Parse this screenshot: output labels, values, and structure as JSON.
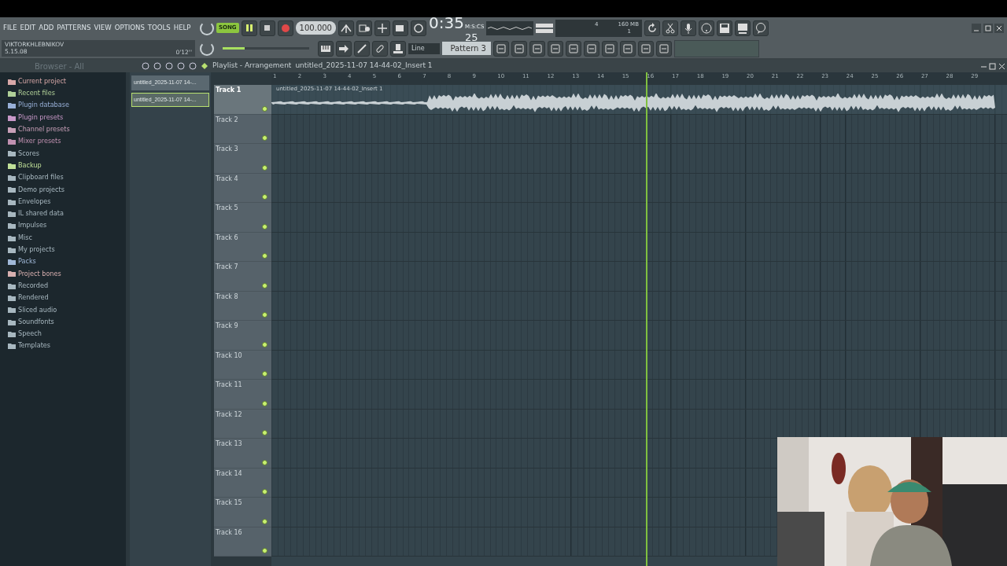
{
  "menu": [
    "FILE",
    "EDIT",
    "ADD",
    "PATTERNS",
    "VIEW",
    "OPTIONS",
    "TOOLS",
    "HELP"
  ],
  "hint_panel": {
    "user": "VIKTORKHLEBNIKOV",
    "version": "5.15.08",
    "time": "0'12''"
  },
  "transport": {
    "mode": "SONG",
    "song_mode": true,
    "playing": true,
    "tempo": "100.000",
    "master_volume": {
      "level": 0.25
    }
  },
  "clock": {
    "time": "0:35",
    "fraction": "25",
    "unit": "M:S:CS"
  },
  "monitor": {
    "voices": "4",
    "memory": "160 MB",
    "polyphony": "1"
  },
  "snap": "Line",
  "pattern": "Pattern 3",
  "browser": {
    "title": "Browser - All",
    "items": [
      {
        "label": "Current project",
        "color": "#d8a8a8"
      },
      {
        "label": "Recent files",
        "color": "#b0d098"
      },
      {
        "label": "Plugin database",
        "color": "#98b0d8"
      },
      {
        "label": "Plugin presets",
        "color": "#c898c8"
      },
      {
        "label": "Channel presets",
        "color": "#c8a0b8"
      },
      {
        "label": "Mixer presets",
        "color": "#c090b0"
      },
      {
        "label": "Scores",
        "color": "#a8b8c0"
      },
      {
        "label": "Backup",
        "color": "#c0e098"
      },
      {
        "label": "Clipboard files",
        "color": "#a8b8c0"
      },
      {
        "label": "Demo projects",
        "color": "#a8b8c0"
      },
      {
        "label": "Envelopes",
        "color": "#a8b8c0"
      },
      {
        "label": "IL shared data",
        "color": "#a8b8c0"
      },
      {
        "label": "Impulses",
        "color": "#a8b8c0"
      },
      {
        "label": "Misc",
        "color": "#a8b8c0"
      },
      {
        "label": "My projects",
        "color": "#a8b8c0"
      },
      {
        "label": "Packs",
        "color": "#a0b8d8"
      },
      {
        "label": "Project bones",
        "color": "#d8b0b0"
      },
      {
        "label": "Recorded",
        "color": "#a8b8c0"
      },
      {
        "label": "Rendered",
        "color": "#a8b8c0"
      },
      {
        "label": "Sliced audio",
        "color": "#a8b8c0"
      },
      {
        "label": "Soundfonts",
        "color": "#a8b8c0"
      },
      {
        "label": "Speech",
        "color": "#a8b8c0"
      },
      {
        "label": "Templates",
        "color": "#a8b8c0"
      }
    ]
  },
  "playlist": {
    "title": "Playlist - Arrangement",
    "clip_name": "untitled_2025-11-07 14-44-02_Insert 1",
    "clips": [
      {
        "label": "untitled_2025-11-07 14-...",
        "selected": false
      },
      {
        "label": "untitled_2025-11-07 14-...",
        "selected": true
      }
    ],
    "bars": [
      "1",
      "2",
      "3",
      "4",
      "5",
      "6",
      "7",
      "8",
      "9",
      "10",
      "11",
      "12",
      "13",
      "14",
      "15",
      "16",
      "17",
      "18",
      "19",
      "20",
      "21",
      "22",
      "23",
      "24",
      "25",
      "26",
      "27",
      "28",
      "29"
    ],
    "playhead": {
      "level": 0.509
    },
    "tracks": [
      {
        "name": "Track 1",
        "selected": true,
        "clip": "untitled_2025-11-07 14-44-02_Insert 1"
      },
      {
        "name": "Track 2",
        "selected": false
      },
      {
        "name": "Track 3",
        "selected": false
      },
      {
        "name": "Track 4",
        "selected": false
      },
      {
        "name": "Track 5",
        "selected": false
      },
      {
        "name": "Track 6",
        "selected": false
      },
      {
        "name": "Track 7",
        "selected": false
      },
      {
        "name": "Track 8",
        "selected": false
      },
      {
        "name": "Track 9",
        "selected": false
      },
      {
        "name": "Track 10",
        "selected": false
      },
      {
        "name": "Track 11",
        "selected": false
      },
      {
        "name": "Track 12",
        "selected": false
      },
      {
        "name": "Track 13",
        "selected": false
      },
      {
        "name": "Track 14",
        "selected": false
      },
      {
        "name": "Track 15",
        "selected": false
      },
      {
        "name": "Track 16",
        "selected": false
      }
    ]
  }
}
